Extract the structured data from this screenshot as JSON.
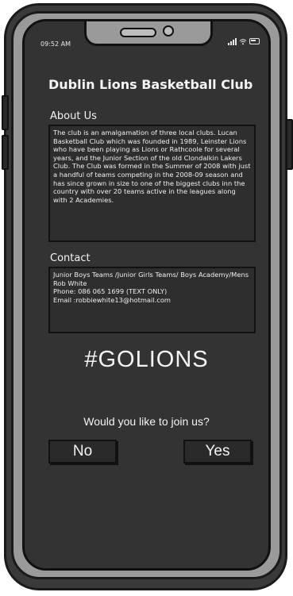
{
  "status_bar": {
    "time": "09:52 AM",
    "icons": [
      "signal-icon",
      "wifi-icon",
      "battery-icon"
    ]
  },
  "page": {
    "title": "Dublin Lions Basketball Club"
  },
  "about": {
    "heading": "About Us",
    "text": "The club is an amalgamation of three local clubs. Lucan Basketball Club which was founded in 1989, Leinster Lions who have been playing as Lions or Rathcoole for several years, and the Junior Section of the old Clondalkin Lakers Club. The Club was formed in the Summer of 2008 with just a handful of teams competing in the 2008-09 season and has since grown in size to one of the biggest clubs inn the country with over 20 teams active in the leagues along with 2 Academies."
  },
  "contact": {
    "heading": "Contact",
    "lines": [
      "Junior Boys Teams /Junior Girls Teams/ Boys Academy/Mens",
      "Rob White",
      "Phone: 086 065 1699 (TEXT ONLY)",
      "Email :robbiewhite13@hotmail.com"
    ]
  },
  "hashtag": "#GOLIONS",
  "join": {
    "question": "Would you like to join us?",
    "no_label": "No",
    "yes_label": "Yes"
  },
  "colors": {
    "screen_bg": "#333333",
    "text": "#f4f4f4",
    "frame": "#3a3a3a",
    "bezel": "#9a9a9a"
  }
}
